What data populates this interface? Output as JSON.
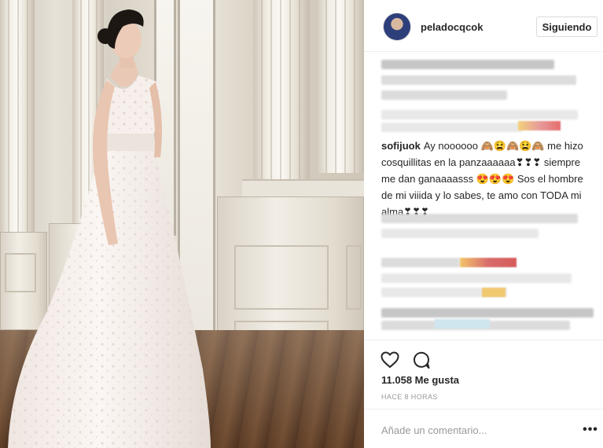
{
  "post": {
    "username": "peladocqcok",
    "follow_label": "Siguiendo",
    "likes": "11.058 Me gusta",
    "time": "HACE 8 HORAS",
    "comment_placeholder": "Añade un comentario...",
    "more_label": "•••"
  },
  "comment": {
    "username": "sofijuok",
    "text": "Ay noooooo 🙈😫🙈😫🙈 me hizo cosquillitas en la panzaaaaaa❣❣❣ siempre me dan ganaaaasss 😍😍😍 Sos el hombre de mi viiida y lo sabes, te amo con TODA mi alma❣❣❣"
  },
  "icons": {
    "like": "heart-icon",
    "comment": "comment-bubble-icon",
    "more": "more-options-icon",
    "avatar": "user-avatar"
  },
  "colors": {
    "text": "#262626",
    "muted": "#999999",
    "border": "#dbdbdb",
    "divider": "#efefef"
  }
}
